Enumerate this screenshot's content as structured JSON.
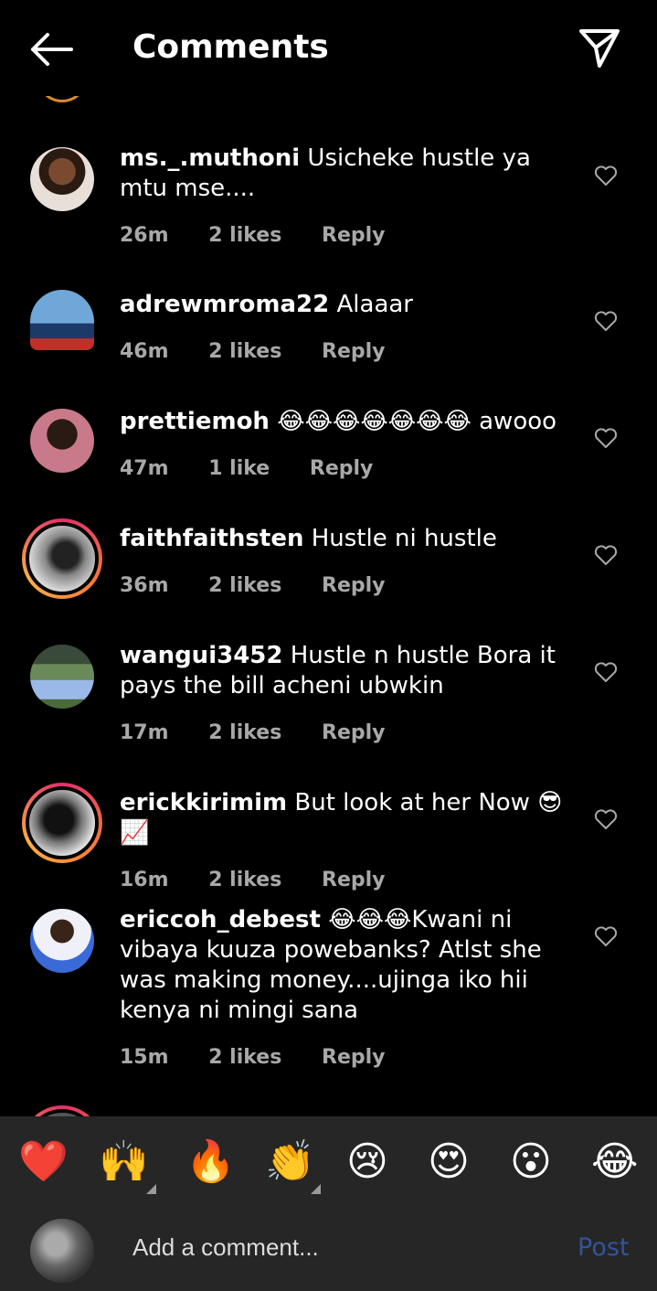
{
  "header": {
    "title": "Comments"
  },
  "comments": [
    {
      "user": "ms._.muthoni",
      "text": "Usicheke hustle ya mtu mse....",
      "time": "26m",
      "likes": "2 likes",
      "reply": "Reply"
    },
    {
      "user": "adrewmroma22",
      "text": "Alaaar",
      "time": "46m",
      "likes": "2 likes",
      "reply": "Reply"
    },
    {
      "user": "prettiemoh",
      "text": "😂😂😂😂😂😂😂 awooo",
      "time": "47m",
      "likes": "1 like",
      "reply": "Reply"
    },
    {
      "user": "faithfaithsten",
      "text": "Hustle ni hustle",
      "time": "36m",
      "likes": "2 likes",
      "reply": "Reply"
    },
    {
      "user": "wangui3452",
      "text": "Hustle n hustle Bora it pays the bill acheni ubwkin",
      "time": "17m",
      "likes": "2 likes",
      "reply": "Reply"
    },
    {
      "user": "erickkirimim",
      "text": "But look at her Now 😎📈",
      "time": "16m",
      "likes": "2 likes",
      "reply": "Reply"
    },
    {
      "user": "ericcoh_debest",
      "text": "😂😂😂Kwani ni vibaya kuuza powebanks? Atlst she was making money....ujinga iko hii kenya ni mingi sana",
      "time": "15m",
      "likes": "2 likes",
      "reply": "Reply"
    }
  ],
  "emoji_bar": [
    "❤️",
    "🙌",
    "🔥",
    "👏",
    "😢",
    "😍",
    "😮",
    "😂"
  ],
  "composer": {
    "placeholder": "Add a comment...",
    "post_label": "Post"
  },
  "colors": {
    "background": "#000000",
    "panel": "#262626",
    "meta_text": "#a8a8a8",
    "post_disabled": "#31549e",
    "story_ring": "#e1306c"
  }
}
